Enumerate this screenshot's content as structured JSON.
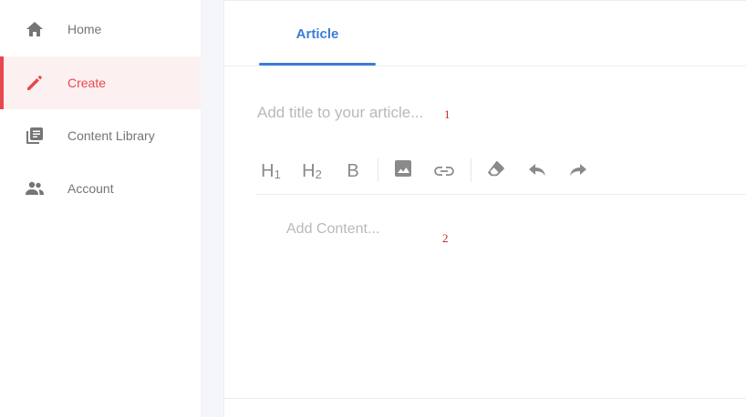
{
  "sidebar": {
    "items": [
      {
        "label": "Home",
        "icon": "home-icon",
        "active": false
      },
      {
        "label": "Create",
        "icon": "pencil-icon",
        "active": true
      },
      {
        "label": "Content Library",
        "icon": "library-icon",
        "active": false
      },
      {
        "label": "Account",
        "icon": "people-icon",
        "active": false
      }
    ]
  },
  "editor": {
    "tab_label": "Article",
    "title_placeholder": "Add title to your article...",
    "title_marker": "1",
    "content_placeholder": "Add Content...",
    "content_marker": "2",
    "toolbar": {
      "h1_main": "H",
      "h1_sub": "1",
      "h2_main": "H",
      "h2_sub": "2",
      "bold": "B",
      "icons": [
        "image-icon",
        "link-icon",
        "eraser-icon",
        "undo-icon",
        "redo-icon"
      ]
    }
  },
  "colors": {
    "accent_red": "#e8474f",
    "accent_blue": "#3b7dd8",
    "icon_gray": "#8a8a8a"
  }
}
